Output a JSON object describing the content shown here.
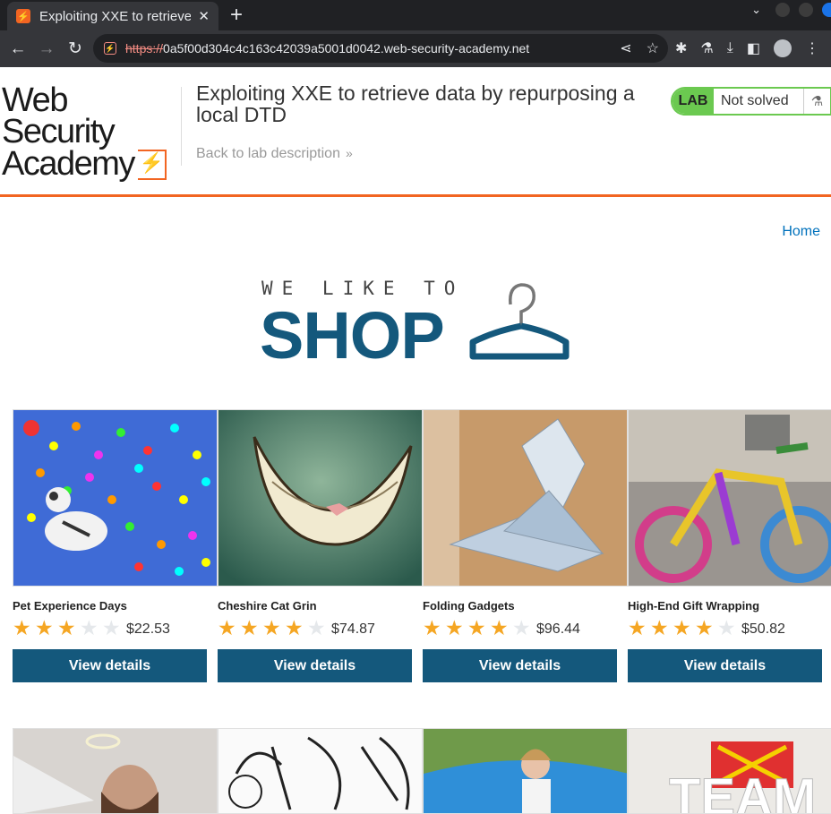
{
  "browser": {
    "tab_title": "Exploiting XXE to retrieve data by repurposing a local DTD",
    "url_scheme": "https://",
    "url_host": "0a5f00d304c4c163c42039a5001d0042.web-security-academy.net"
  },
  "header": {
    "logo_line1": "Web Security",
    "logo_line2": "Academy",
    "lab_title": "Exploiting XXE to retrieve data by repurposing a local DTD",
    "back_link": "Back to lab description",
    "badge_label": "LAB",
    "badge_status": "Not solved"
  },
  "nav": {
    "home": "Home"
  },
  "hero": {
    "tagline": "WE LIKE TO",
    "word": "SHOP"
  },
  "products": [
    {
      "name": "Pet Experience Days",
      "rating": 3,
      "price": "$22.53",
      "button": "View details"
    },
    {
      "name": "Cheshire Cat Grin",
      "rating": 4,
      "price": "$74.87",
      "button": "View details"
    },
    {
      "name": "Folding Gadgets",
      "rating": 4,
      "price": "$96.44",
      "button": "View details"
    },
    {
      "name": "High-End Gift Wrapping",
      "rating": 4,
      "price": "$50.82",
      "button": "View details"
    }
  ],
  "colors": {
    "accent": "#f26522",
    "brand": "#14587c",
    "lab_green": "#6bc950",
    "star": "#f5a623"
  }
}
